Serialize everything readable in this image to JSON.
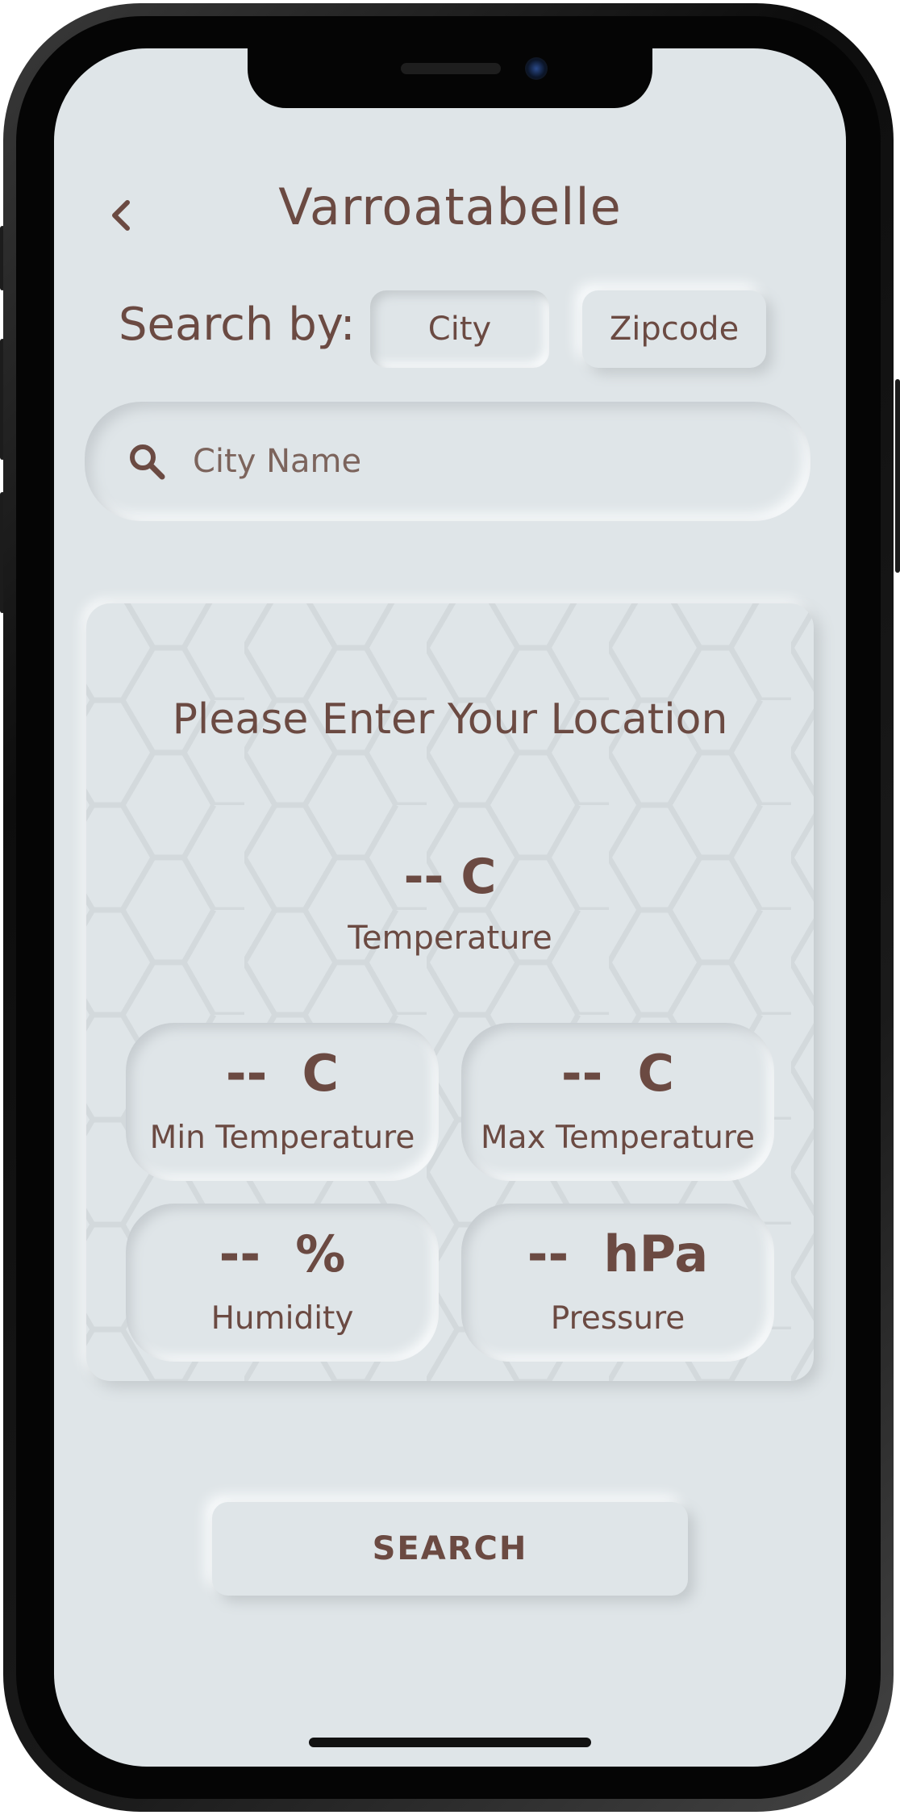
{
  "header": {
    "title": "Varroatabelle",
    "back_icon": "chevron-left-icon"
  },
  "search_by": {
    "label": "Search by:",
    "options": [
      {
        "label": "City",
        "selected": true
      },
      {
        "label": "Zipcode",
        "selected": false
      }
    ]
  },
  "search": {
    "placeholder": "City Name",
    "icon": "search-icon"
  },
  "weather": {
    "prompt": "Please Enter Your Location",
    "temperature": {
      "value": "-- C",
      "label": "Temperature"
    },
    "stats": [
      {
        "value": "--  C",
        "label": "Min Temperature"
      },
      {
        "value": "--  C",
        "label": "Max Temperature"
      },
      {
        "value": "--  %",
        "label": "Humidity"
      },
      {
        "value": "--  hPa",
        "label": "Pressure"
      }
    ]
  },
  "action": {
    "search_label": "SEARCH"
  },
  "colors": {
    "background": "#dfe5e8",
    "text": "#6b4a42",
    "frame": "#0d0d0d"
  }
}
